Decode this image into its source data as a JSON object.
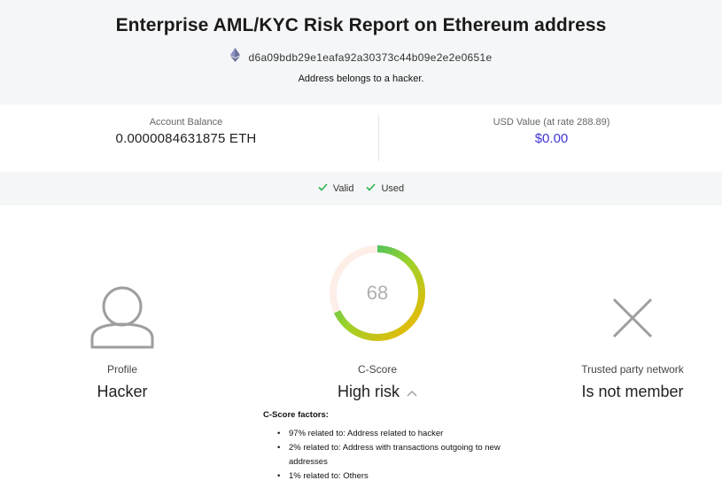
{
  "header": {
    "title": "Enterprise AML/KYC Risk Report on Ethereum address",
    "address": "d6a09bdb29e1eafa92a30373c44b09e2e2e0651e",
    "note": "Address belongs to a hacker."
  },
  "balance": {
    "account_label": "Account Balance",
    "account_value": "0.0000084631875 ETH",
    "usd_label": "USD Value (at rate 288.89)",
    "usd_value": "$0.00"
  },
  "status": {
    "valid_label": "Valid",
    "used_label": "Used"
  },
  "profile": {
    "label": "Profile",
    "value": "Hacker"
  },
  "cscore": {
    "label": "C-Score",
    "value": "High risk",
    "score": "68",
    "gauge_fill_fraction": 0.68
  },
  "trusted": {
    "label": "Trusted party network",
    "value": "Is not member"
  },
  "factors": {
    "title": "C-Score factors:",
    "items": [
      "97% related to: Address related to hacker",
      "2% related to: Address with transactions outgoing to new addresses",
      "1% related to: Others"
    ]
  },
  "colors": {
    "accent_usd": "#3f35d8",
    "check_green": "#2bb24c",
    "gauge_start": "#f7b500",
    "gauge_end": "#12b886"
  }
}
